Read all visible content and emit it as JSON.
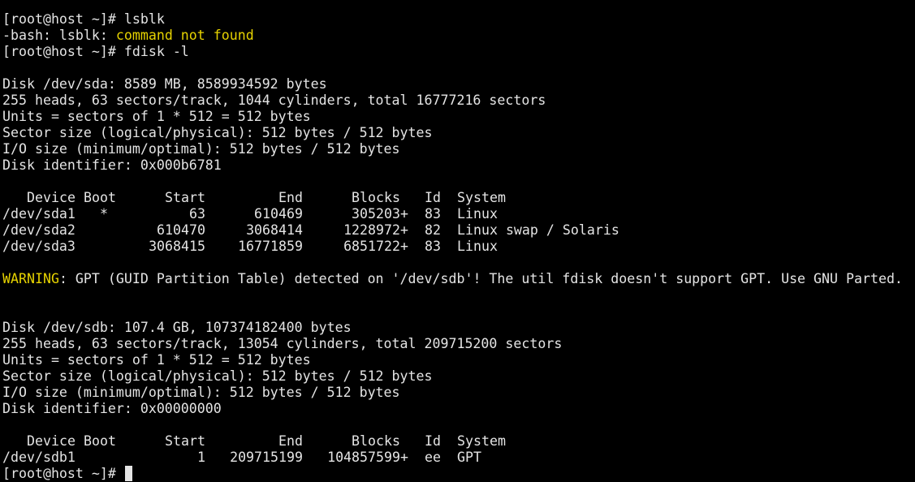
{
  "prompt": "[root@host ~]#",
  "commands": {
    "lsblk": "lsblk",
    "fdisk": "fdisk -l"
  },
  "lsblk_error": {
    "prefix": "-bash: lsblk: ",
    "message": "command not found"
  },
  "disks": [
    {
      "info": [
        "Disk /dev/sda: 8589 MB, 8589934592 bytes",
        "255 heads, 63 sectors/track, 1044 cylinders, total 16777216 sectors",
        "Units = sectors of 1 * 512 = 512 bytes",
        "Sector size (logical/physical): 512 bytes / 512 bytes",
        "I/O size (minimum/optimal): 512 bytes / 512 bytes",
        "Disk identifier: 0x000b6781"
      ],
      "headers": {
        "device": "Device",
        "boot": "Boot",
        "start": "Start",
        "end": "End",
        "blocks": "Blocks",
        "id": "Id",
        "system": "System"
      },
      "partitions": [
        {
          "device": "/dev/sda1",
          "boot": "*",
          "start": "63",
          "end": "610469",
          "blocks": "305203",
          "plus": "+",
          "id": "83",
          "system": "Linux"
        },
        {
          "device": "/dev/sda2",
          "boot": "",
          "start": "610470",
          "end": "3068414",
          "blocks": "1228972",
          "plus": "+",
          "id": "82",
          "system": "Linux swap / Solaris"
        },
        {
          "device": "/dev/sda3",
          "boot": "",
          "start": "3068415",
          "end": "16771859",
          "blocks": "6851722",
          "plus": "+",
          "id": "83",
          "system": "Linux"
        }
      ]
    },
    {
      "info": [
        "Disk /dev/sdb: 107.4 GB, 107374182400 bytes",
        "255 heads, 63 sectors/track, 13054 cylinders, total 209715200 sectors",
        "Units = sectors of 1 * 512 = 512 bytes",
        "Sector size (logical/physical): 512 bytes / 512 bytes",
        "I/O size (minimum/optimal): 512 bytes / 512 bytes",
        "Disk identifier: 0x00000000"
      ],
      "headers": {
        "device": "Device",
        "boot": "Boot",
        "start": "Start",
        "end": "End",
        "blocks": "Blocks",
        "id": "Id",
        "system": "System"
      },
      "partitions": [
        {
          "device": "/dev/sdb1",
          "boot": "",
          "start": "1",
          "end": "209715199",
          "blocks": "104857599",
          "plus": "+",
          "id": "ee",
          "system": "GPT"
        }
      ]
    }
  ],
  "warning": {
    "label": "WARNING",
    "text": ": GPT (GUID Partition Table) detected on '/dev/sdb'! The util fdisk doesn't support GPT. Use GNU Parted."
  },
  "colors": {
    "background": "#000000",
    "foreground": "#e4e4e4",
    "highlight": "#e6d200"
  }
}
